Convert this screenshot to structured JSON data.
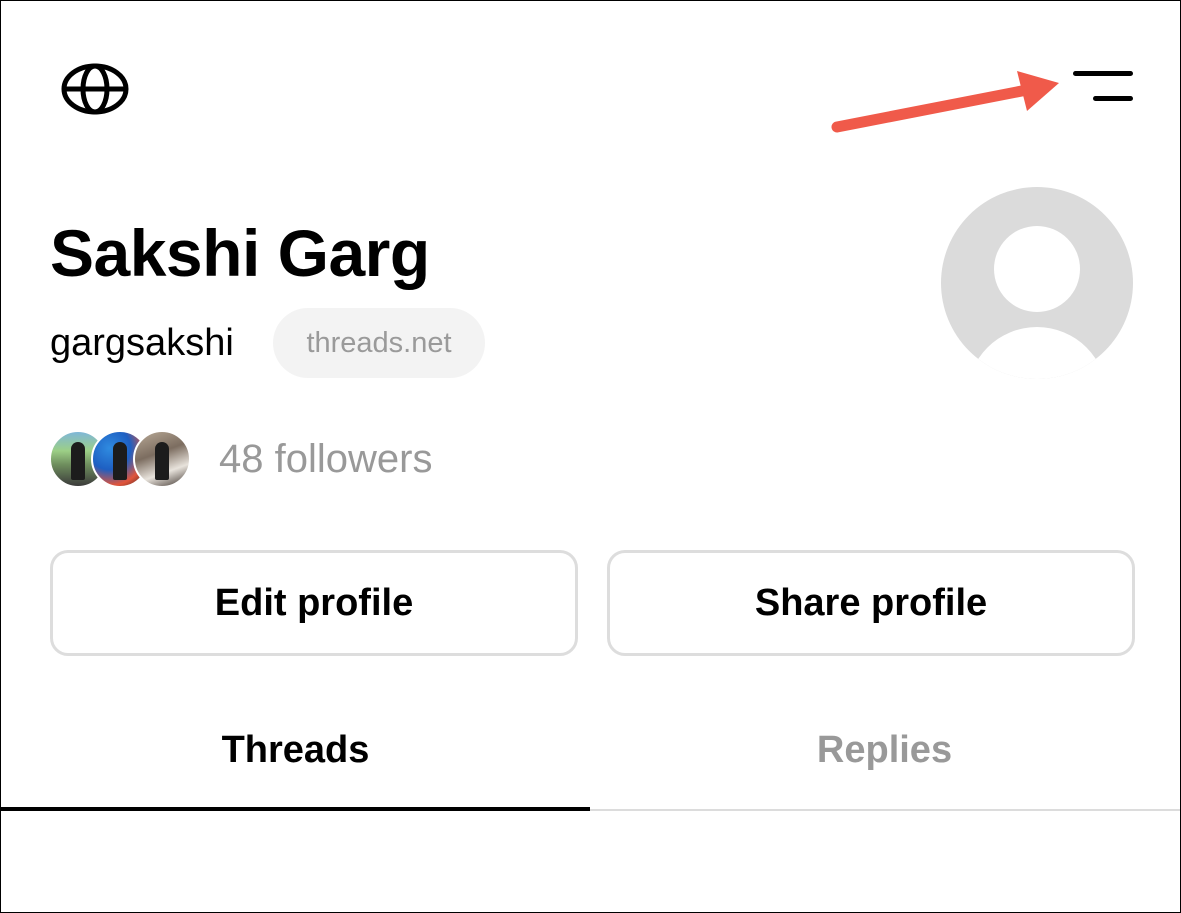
{
  "header": {
    "globe_icon": "globe-icon",
    "menu_icon": "menu-icon",
    "annotation_arrow_color": "#f05a4a"
  },
  "profile": {
    "name": "Sakshi Garg",
    "handle": "gargsakshi",
    "domain_badge": "threads.net",
    "avatar_icon": "default-avatar-icon",
    "followers_text": "48 followers"
  },
  "actions": {
    "edit_label": "Edit profile",
    "share_label": "Share profile"
  },
  "tabs": [
    {
      "label": "Threads",
      "active": true
    },
    {
      "label": "Replies",
      "active": false
    }
  ],
  "colors": {
    "text_primary": "#000000",
    "text_secondary": "#999999",
    "badge_bg": "#f3f3f3",
    "button_border": "#dddddd",
    "avatar_bg": "#dbdbdb"
  }
}
